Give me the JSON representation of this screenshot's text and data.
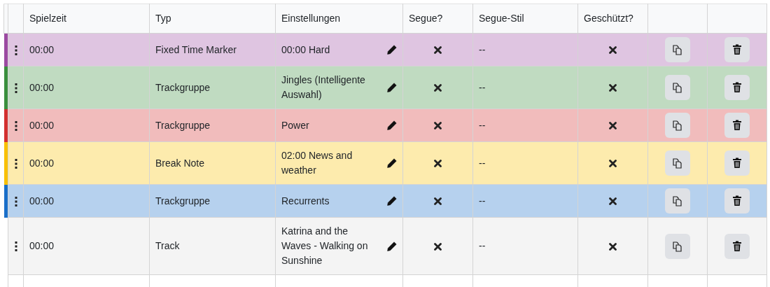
{
  "table": {
    "columns": [
      "Spielzeit",
      "Typ",
      "Einstellungen",
      "Segue?",
      "Segue-Stil",
      "Geschützt?"
    ],
    "rows": [
      {
        "color": "#9c4aa2",
        "time": "00:00",
        "type": "Fixed Time Marker",
        "settings": "00:00 Hard",
        "segue": false,
        "segue_style": "--",
        "protected": false
      },
      {
        "color": "#3a8f3d",
        "time": "00:00",
        "type": "Trackgruppe",
        "settings": "Jingles (Intelligente Auswahl)",
        "segue": false,
        "segue_style": "--",
        "protected": false
      },
      {
        "color": "#d32f2f",
        "time": "00:00",
        "type": "Trackgruppe",
        "settings": "Power",
        "segue": false,
        "segue_style": "--",
        "protected": false
      },
      {
        "color": "#f9c000",
        "time": "00:00",
        "type": "Break Note",
        "settings": "02:00 News and weather",
        "segue": false,
        "segue_style": "--",
        "protected": false
      },
      {
        "color": "#1a6fc9",
        "time": "00:00",
        "type": "Trackgruppe",
        "settings": "Recurrents",
        "segue": false,
        "segue_style": "--",
        "protected": false
      },
      {
        "time": "00:00",
        "type": "Track",
        "settings": "Katrina and the Waves - Walking on Sunshine",
        "segue": false,
        "segue_style": "--",
        "protected": false
      }
    ]
  }
}
